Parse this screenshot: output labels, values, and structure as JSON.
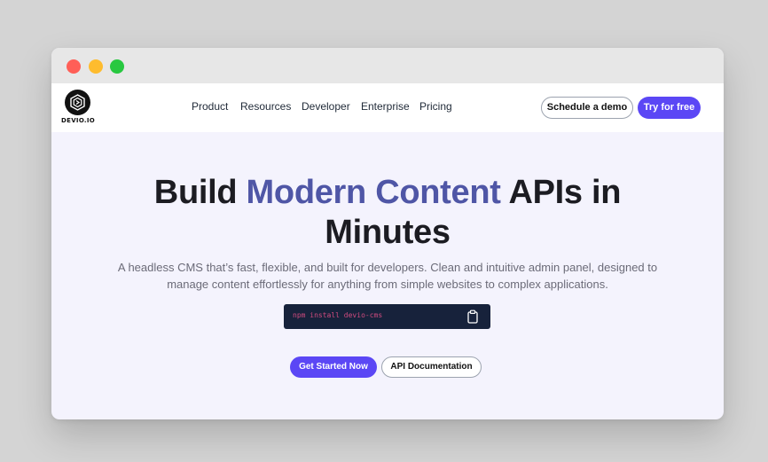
{
  "brand": {
    "name": "DEVIO.IO"
  },
  "nav": {
    "links": [
      "Product",
      "Resources",
      "Developer",
      "Enterprise",
      "Pricing"
    ],
    "schedule_label": "Schedule a demo",
    "try_label": "Try for free"
  },
  "hero": {
    "title_part1": "Build ",
    "title_accent": "Modern Content",
    "title_part2": " APIs in",
    "title_line2": "Minutes",
    "subtitle": "A headless CMS that’s fast, flexible, and built for developers. Clean and intuitive admin panel, designed to manage content effortlessly for anything from simple websites to complex applications.",
    "install_command": "npm install devio-cms",
    "primary_cta": "Get Started Now",
    "secondary_cta": "API Documentation"
  },
  "colors": {
    "accent": "#5b47f5",
    "title_accent": "#4f56a6",
    "code_bg": "#17223b",
    "code_text": "#d14b7f"
  },
  "icons": {
    "window_controls": [
      "close-dot",
      "minimize-dot",
      "maximize-dot"
    ],
    "copy": "clipboard-icon",
    "logo": "logo-mark-icon"
  }
}
